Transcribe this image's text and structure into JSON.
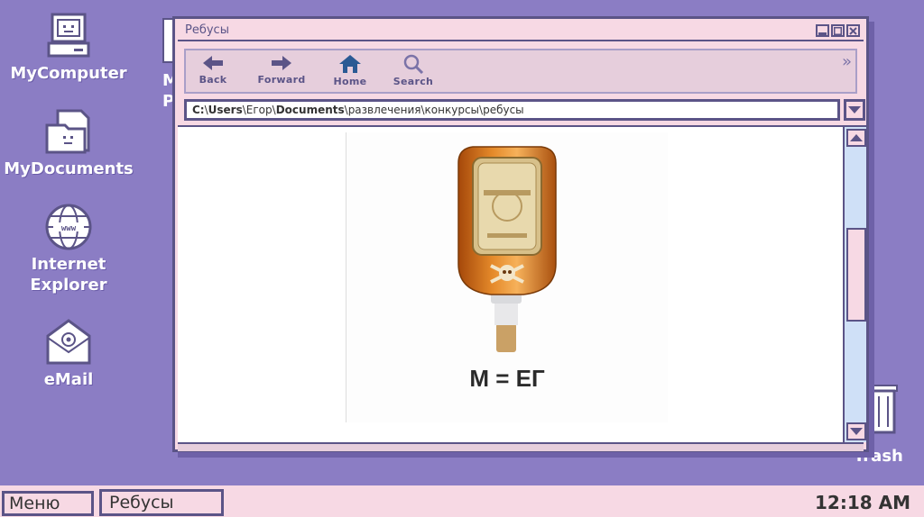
{
  "desktop": {
    "icons": [
      {
        "label": "MyComputer",
        "icon": "computer-icon"
      },
      {
        "label": "MyDocuments",
        "icon": "folder-icon"
      },
      {
        "label": "Internet\nExplorer",
        "icon": "globe-icon"
      },
      {
        "label": "eMail",
        "icon": "email-icon"
      }
    ],
    "partial_icon_text": "M\nP",
    "trash_label": "Trash"
  },
  "window": {
    "title": "Ребусы",
    "toolbar": {
      "back": "Back",
      "forward": "Forward",
      "home": "Home",
      "search": "Search"
    },
    "address": {
      "drive": "C:",
      "users": "Users",
      "user": "Егор",
      "documents": "Documents",
      "folder1": "развлечения",
      "folder2": "конкурсы",
      "folder3": "ребусы"
    },
    "content": {
      "caption": "М = ЕГ",
      "image": "bottle-image"
    }
  },
  "taskbar": {
    "start_label": "Меню",
    "task_label": "Ребусы",
    "clock": "12:18 AM"
  },
  "colors": {
    "desktop": "#8b7dc4",
    "window_bg": "#f7d9e4",
    "border": "#5b5487",
    "scroll_track": "#cfe0f7"
  }
}
